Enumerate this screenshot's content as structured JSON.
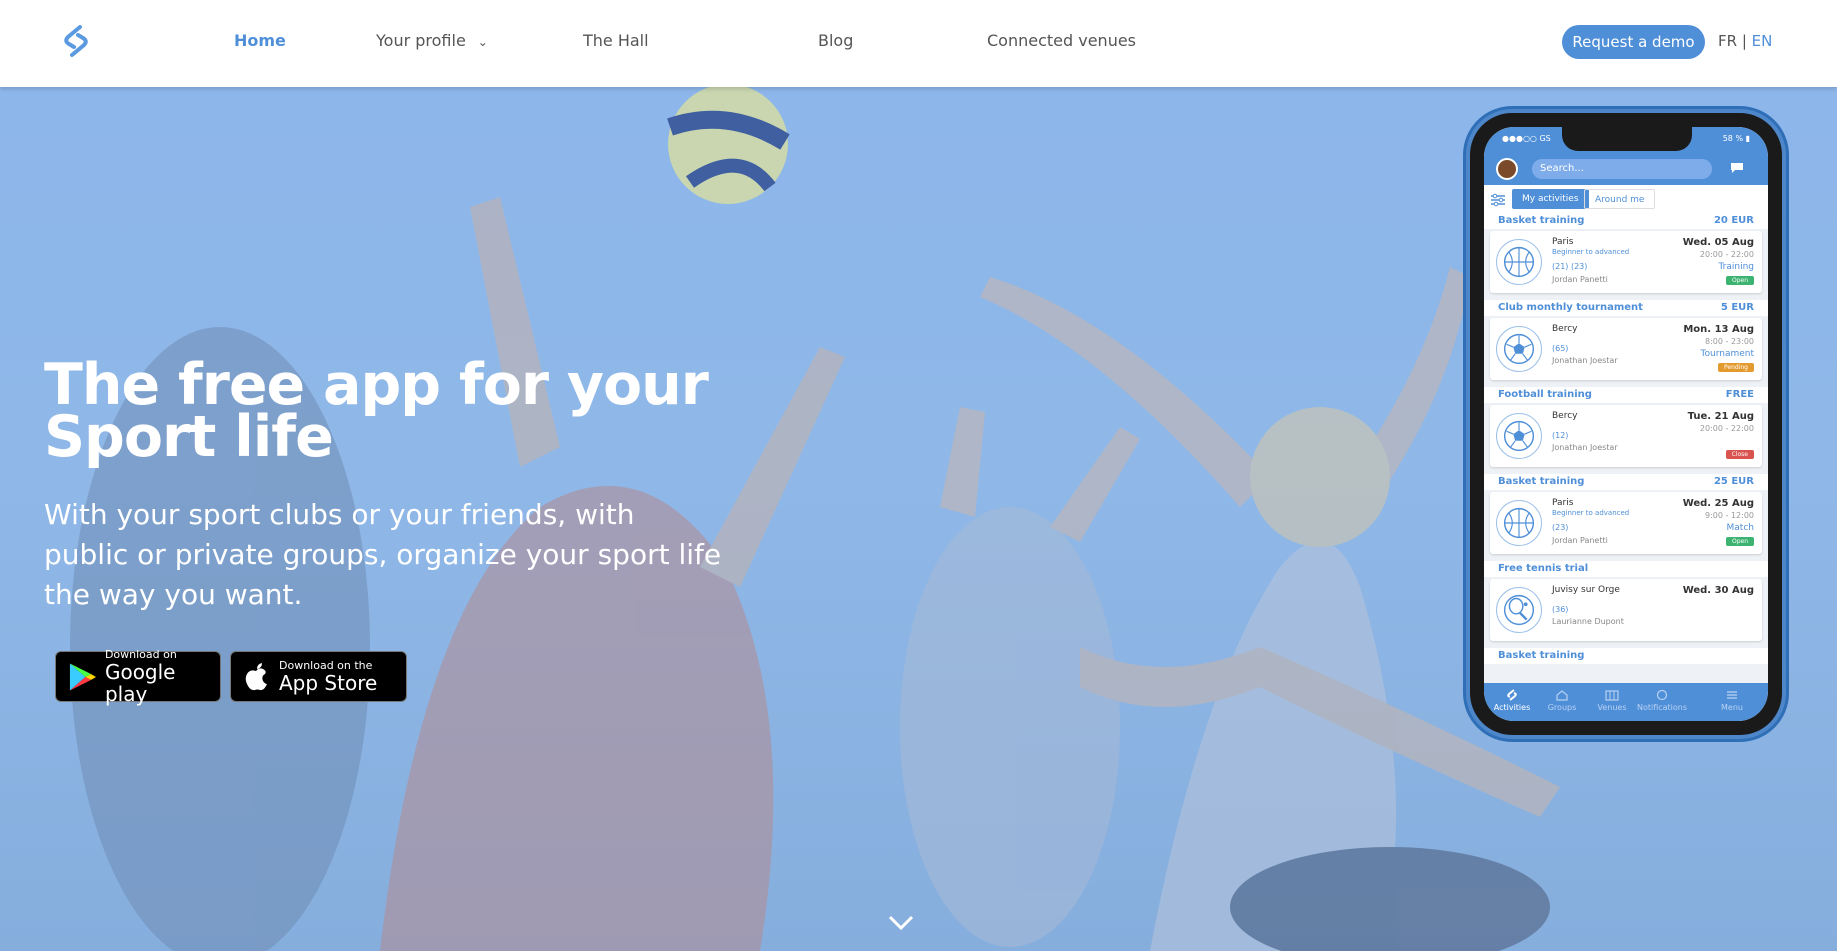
{
  "nav": {
    "items": [
      "Home",
      "Your profile",
      "The Hall",
      "Blog",
      "Connected venues"
    ],
    "cta": "Request a demo",
    "lang_fr": "FR",
    "lang_sep": " | ",
    "lang_en": "EN"
  },
  "hero": {
    "title_line1": "The free app for your",
    "title_line2": "Sport life",
    "subtitle": "With your sport clubs or your friends, with public or private groups, organize your sport life the way you want.",
    "google_small": "Download on",
    "google_big": "Google play",
    "apple_small": "Download on the",
    "apple_big": "App Store"
  },
  "phone": {
    "status_left": "●●●○○ GS",
    "status_right": "58 % ▮",
    "search_placeholder": "Search...",
    "tab_active": "My activities",
    "tab_other": "Around me",
    "activities": [
      {
        "title": "Basket training",
        "price": "20 EUR",
        "place": "Paris",
        "level": "Beginner to advanced",
        "counts": "(21)  (23)",
        "organizer": "Jordan Panetti",
        "date": "Wed. 05 Aug",
        "time": "20:00 - 22:00",
        "type": "Training",
        "status": "Open"
      },
      {
        "title": "Club monthly tournament",
        "price": "5 EUR",
        "place": "Bercy",
        "level": "",
        "counts": "(65)",
        "organizer": "Jonathan Joestar",
        "date": "Mon. 13 Aug",
        "time": "8:00 - 23:00",
        "type": "Tournament",
        "status": "Pending"
      },
      {
        "title": "Football training",
        "price": "FREE",
        "place": "Bercy",
        "level": "",
        "counts": "(12)",
        "organizer": "Jonathan Joestar",
        "date": "Tue. 21 Aug",
        "time": "20:00 - 22:00",
        "type": "",
        "status": "Close"
      },
      {
        "title": "Basket training",
        "price": "25 EUR",
        "place": "Paris",
        "level": "Beginner to advanced",
        "counts": "(23)",
        "organizer": "Jordan Panetti",
        "date": "Wed. 25 Aug",
        "time": "9:00 - 12:00",
        "type": "Match",
        "status": "Open"
      },
      {
        "title": "Free tennis trial",
        "price": "",
        "place": "Juvisy sur Orge",
        "level": "",
        "counts": "(36)",
        "organizer": "Laurianne Dupont",
        "date": "Wed. 30 Aug",
        "time": "",
        "type": "",
        "status": ""
      }
    ],
    "last_section_title": "Basket training",
    "fab": "+",
    "bottom_nav": [
      "Activities",
      "Groups",
      "Venues",
      "Notifications",
      "Menu"
    ]
  },
  "colors": {
    "accent": "#4f8fd8",
    "open": "#3cb371",
    "pending": "#e39b2f",
    "close": "#d9534f"
  }
}
